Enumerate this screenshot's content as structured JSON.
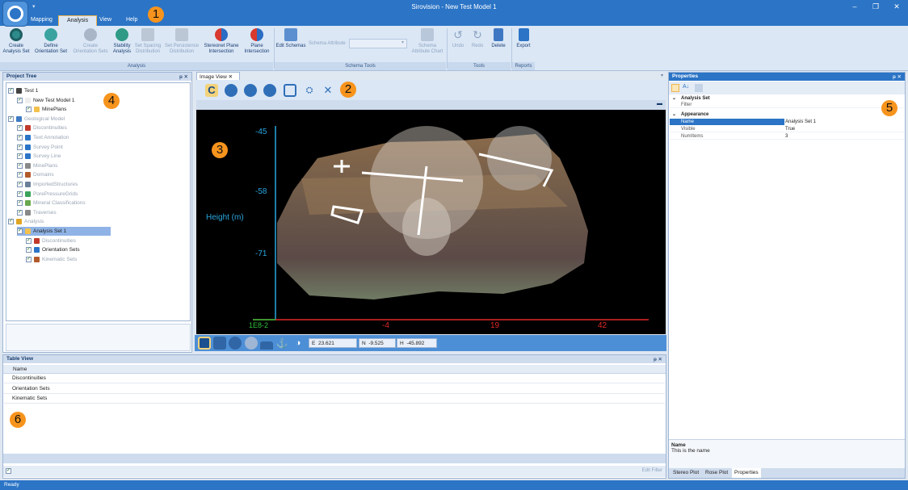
{
  "app": {
    "title": "Sirovision - New Test Model 1",
    "status": "Ready"
  },
  "window_controls": {
    "minimize": "–",
    "maximize": "❐",
    "close": "✕"
  },
  "menu": {
    "tabs": [
      "Mapping",
      "Analysis",
      "View",
      "Help"
    ],
    "active": "Analysis"
  },
  "ribbon": {
    "buttons": [
      {
        "label1": "Create",
        "label2": "Analysis Set",
        "icon": "search-icon",
        "enabled": true
      },
      {
        "label1": "Define",
        "label2": "Orientation Set",
        "icon": "orientation-icon",
        "enabled": true
      },
      {
        "label1": "Create",
        "label2": "Orientation Sets",
        "icon": "orientation-sets-icon",
        "enabled": false
      },
      {
        "label1": "Stability",
        "label2": "Analysis",
        "icon": "stability-icon",
        "enabled": true
      },
      {
        "label1": "Set Spacing",
        "label2": "Distribution",
        "icon": "spacing-icon",
        "enabled": false
      },
      {
        "label1": "Set Persistence",
        "label2": "Distribution",
        "icon": "persistence-icon",
        "enabled": false
      },
      {
        "label1": "Stereonet Plane",
        "label2": "Intersection",
        "icon": "stereonet-icon",
        "enabled": true
      },
      {
        "label1": "Plane",
        "label2": "Intersection",
        "icon": "plane-icon",
        "enabled": true
      }
    ],
    "schema": {
      "edit_label": "Edit Schemas",
      "attribute_label": "Schema Attribute",
      "chart_label1": "Schema",
      "chart_label2": "Attribute Chart"
    },
    "tools": {
      "undo": "Undo",
      "redo": "Redo",
      "delete": "Delete"
    },
    "reports": {
      "export": "Export"
    },
    "groups": [
      "Analysis",
      "Schema Tools",
      "Tools",
      "Reports"
    ]
  },
  "project_tree": {
    "title": "Project Tree",
    "pin": "ᵽ",
    "close": "✕",
    "items": [
      {
        "label": "Test 1",
        "gray": false
      },
      {
        "label": "New Test Model 1",
        "gray": false
      },
      {
        "label": "MinePlans",
        "gray": false
      },
      {
        "label": "Geological Model",
        "gray": true
      },
      {
        "label": "Discontinuities",
        "gray": true
      },
      {
        "label": "Text Annotation",
        "gray": true
      },
      {
        "label": "Survey Point",
        "gray": true
      },
      {
        "label": "Survey Line",
        "gray": true
      },
      {
        "label": "MinePlans",
        "gray": true
      },
      {
        "label": "Domains",
        "gray": true
      },
      {
        "label": "ImportedStructures",
        "gray": true
      },
      {
        "label": "PorePressureGrids",
        "gray": true
      },
      {
        "label": "Mineral Classifications",
        "gray": true
      },
      {
        "label": "Traverses",
        "gray": true
      },
      {
        "label": "Analysis",
        "gray": true
      },
      {
        "label": "Analysis Set 1",
        "gray": false
      },
      {
        "label": "Discontinuities",
        "gray": true
      },
      {
        "label": "Orientation Sets",
        "gray": false
      },
      {
        "label": "Kinematic Sets",
        "gray": true
      }
    ]
  },
  "image_view": {
    "tab_label": "Image View",
    "tab_close": "✕",
    "axis": {
      "y_label": "Height (m)",
      "y_ticks": [
        "-45",
        "-58",
        "-71"
      ],
      "x_ticks": [
        "-4",
        "19",
        "42"
      ],
      "x_origin_label": "1E8-2"
    },
    "coords": {
      "e_label": "E",
      "e_value": "23.621",
      "n_label": "N",
      "n_value": "-9.525",
      "h_label": "H",
      "h_value": "-45.892"
    }
  },
  "table_view": {
    "title": "Table View",
    "column": "Name",
    "rows": [
      "Discontinuities",
      "Orientation Sets",
      "Kinematic Sets"
    ],
    "edit_filter": "Edit Filter"
  },
  "properties": {
    "title": "Properties",
    "category1": "Analysis Set",
    "filter_label": "Filter",
    "category2": "Appearance",
    "rows": [
      {
        "key": "Name",
        "value": "Analysis Set 1"
      },
      {
        "key": "Visible",
        "value": "True"
      },
      {
        "key": "NumItems",
        "value": "3"
      }
    ],
    "desc_title": "Name",
    "desc_text": "This is the name",
    "bottom_tabs": [
      "Stereo Plot",
      "Rose Plot",
      "Properties"
    ]
  },
  "annotations": [
    "1",
    "2",
    "3",
    "4",
    "5",
    "6"
  ],
  "colors": {
    "title_blue": "#2b74c6",
    "ribbon_bg": "#dbe7f5",
    "badge": "#f7941d",
    "selected_row": "#2b74c6"
  }
}
